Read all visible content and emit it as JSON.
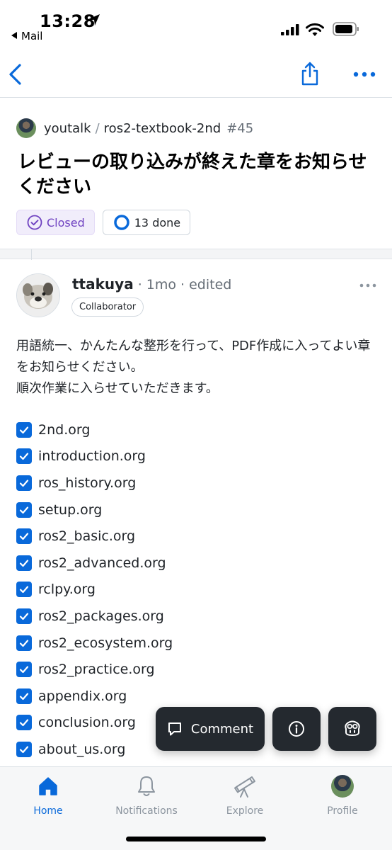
{
  "status_bar": {
    "time": "13:28",
    "back_app": "Mail"
  },
  "repo": {
    "owner": "youtalk",
    "separator": "/",
    "name": "ros2-textbook-2nd",
    "number": "#45"
  },
  "issue": {
    "title": "レビューの取り込みが終えた章をお知らせください",
    "state_label": "Closed",
    "tasks_label": "13 done"
  },
  "comment": {
    "author": "ttakuya",
    "meta": "· 1mo · edited",
    "role": "Collaborator",
    "body_line1": "用語統一、かんたんな整形を行って、PDF作成に入ってよい章をお知らせください。",
    "body_line2": "順次作業に入らせていただきます。",
    "tasks": [
      {
        "label": "2nd.org",
        "checked": true
      },
      {
        "label": "introduction.org",
        "checked": true
      },
      {
        "label": "ros_history.org",
        "checked": true
      },
      {
        "label": "setup.org",
        "checked": true
      },
      {
        "label": "ros2_basic.org",
        "checked": true
      },
      {
        "label": "ros2_advanced.org",
        "checked": true
      },
      {
        "label": "rclpy.org",
        "checked": true
      },
      {
        "label": "ros2_packages.org",
        "checked": true
      },
      {
        "label": "ros2_ecosystem.org",
        "checked": true
      },
      {
        "label": "ros2_practice.org",
        "checked": true
      },
      {
        "label": "appendix.org",
        "checked": true
      },
      {
        "label": "conclusion.org",
        "checked": true
      },
      {
        "label": "about_us.org",
        "checked": true
      }
    ]
  },
  "fab": {
    "comment_label": "Comment"
  },
  "tabs": {
    "home": "Home",
    "notifications": "Notifications",
    "explore": "Explore",
    "profile": "Profile"
  },
  "colors": {
    "accent": "#0969da",
    "closed_purple": "#6f42c1",
    "fab_bg": "#24292f"
  }
}
